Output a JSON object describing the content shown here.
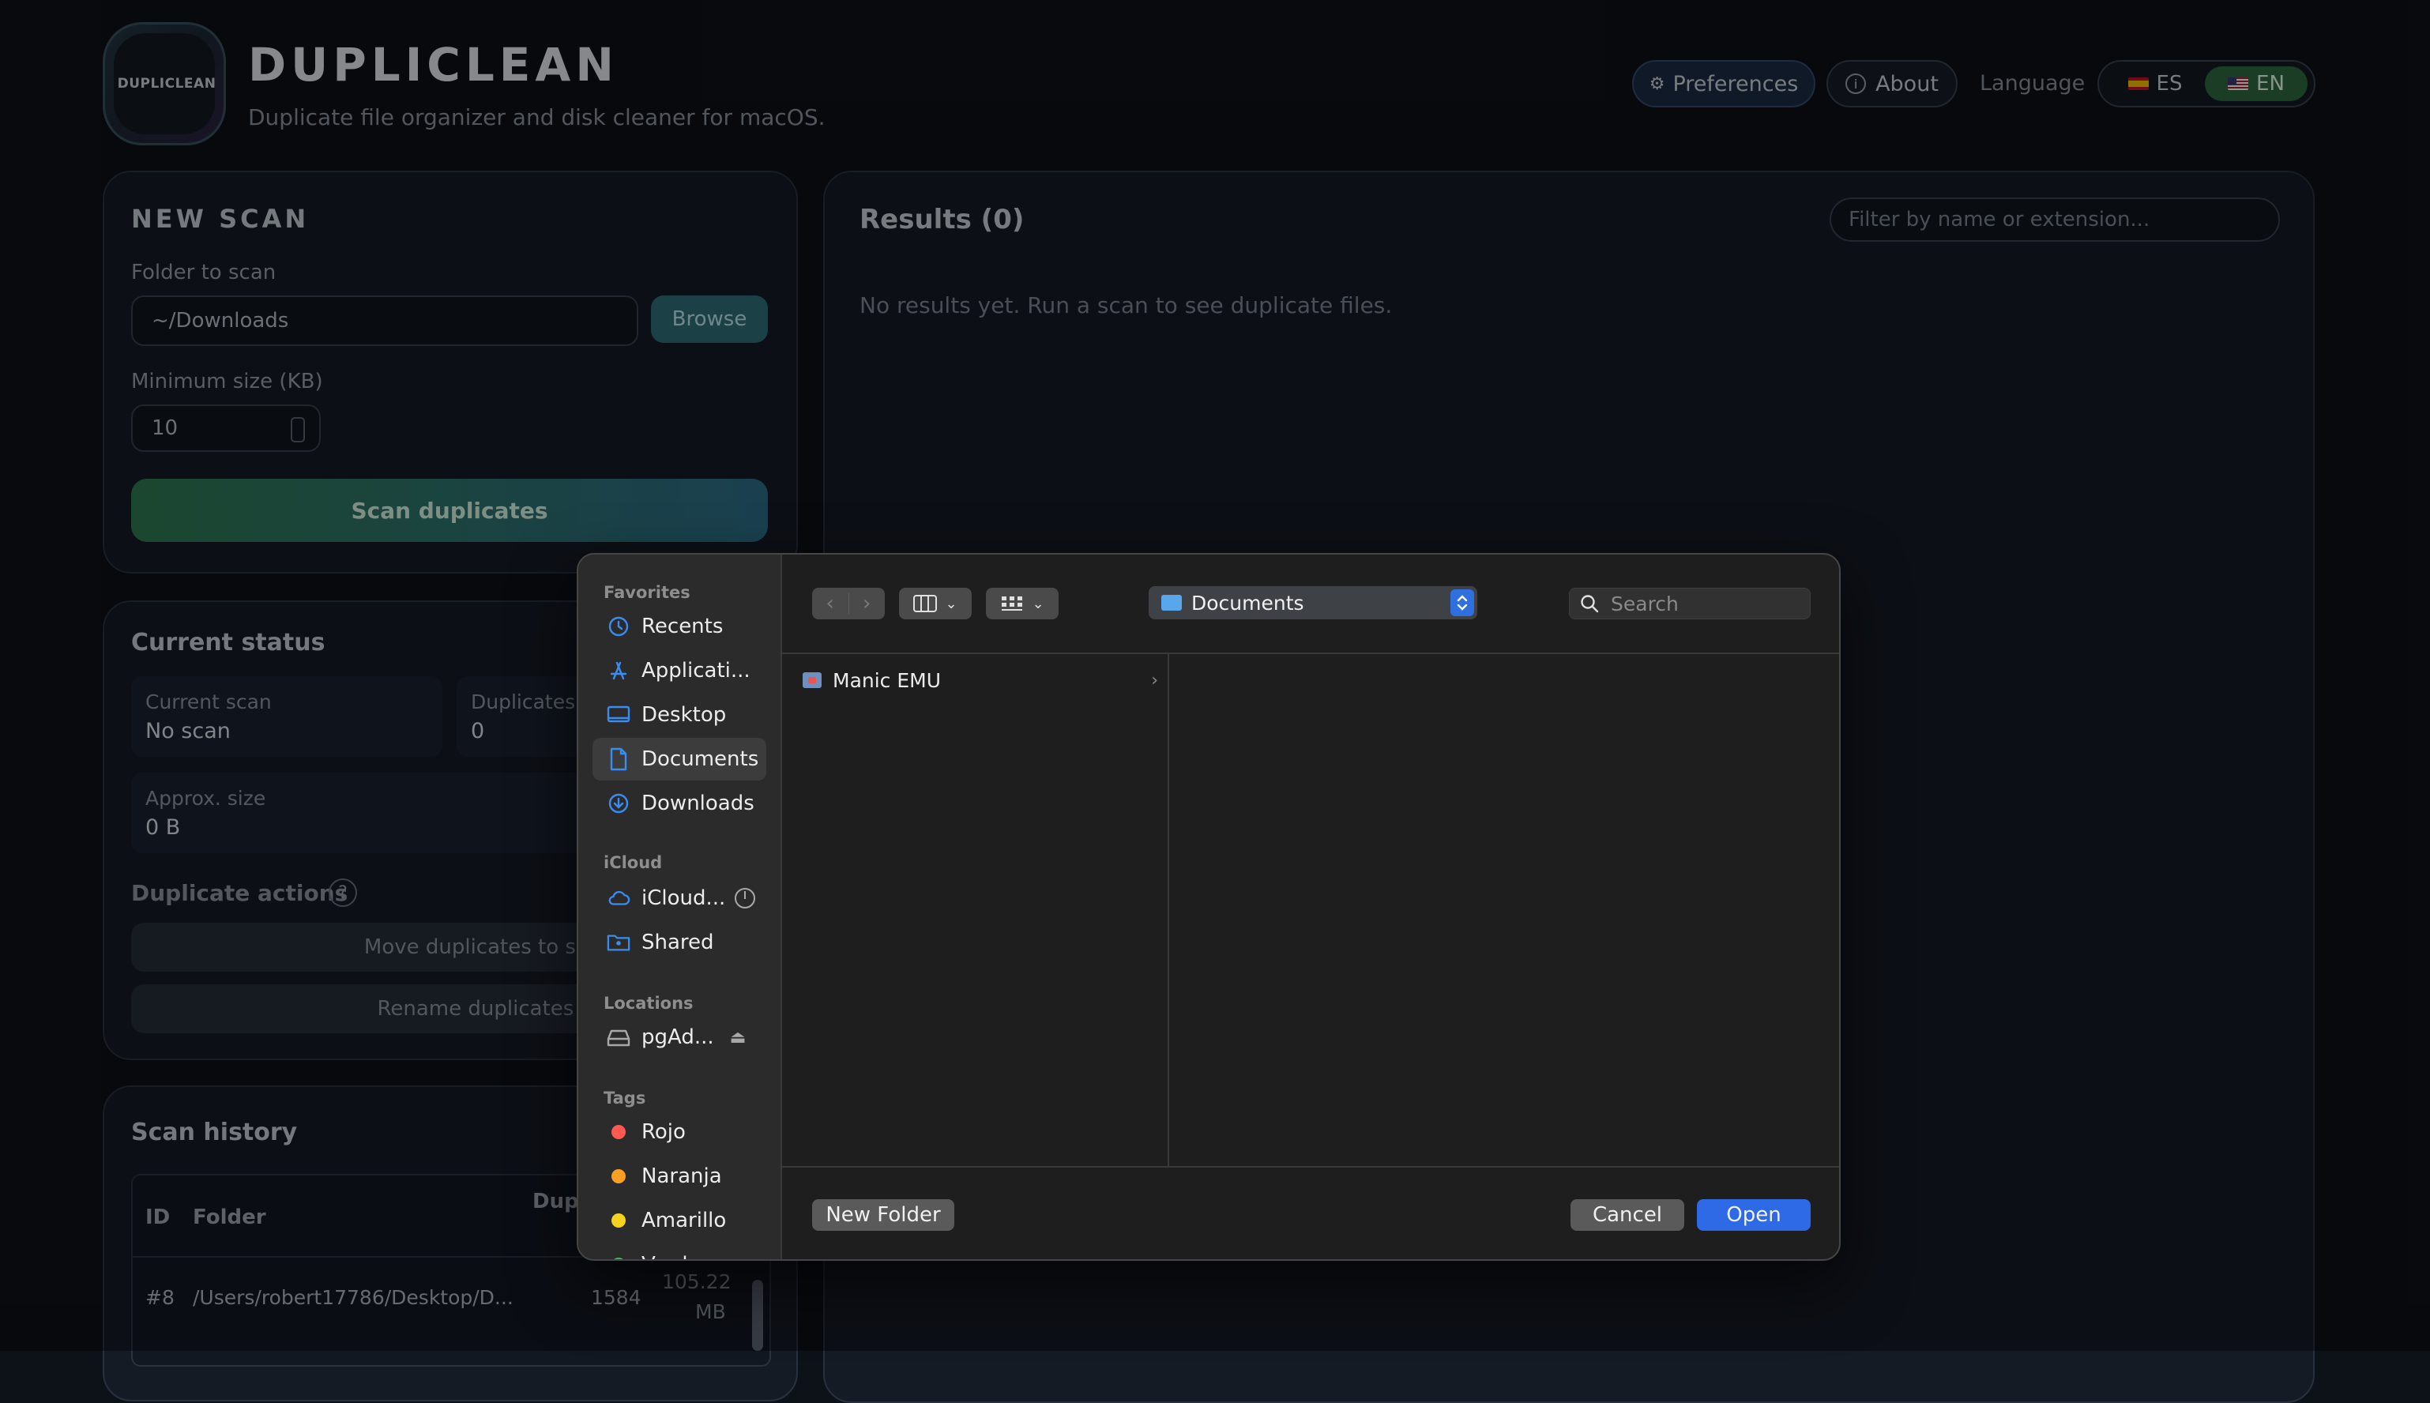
{
  "app": {
    "logo_text": "DUPLICLEAN",
    "title": "DUPLICLEAN",
    "subtitle": "Duplicate file organizer and disk cleaner for macOS."
  },
  "header": {
    "preferences": "Preferences",
    "about": "About",
    "language_label": "Language",
    "lang_es": "ES",
    "lang_en": "EN",
    "active_language": "EN"
  },
  "scan": {
    "title": "NEW SCAN",
    "folder_label": "Folder to scan",
    "folder_value": "~/Downloads",
    "browse": "Browse",
    "min_size_label": "Minimum size (KB)",
    "min_size_value": "10",
    "scan_button": "Scan duplicates"
  },
  "status": {
    "title": "Current status",
    "current_scan_label": "Current scan",
    "current_scan_value": "No scan",
    "duplicates_label": "Duplicates",
    "duplicates_value": "0",
    "approx_size_label": "Approx. size",
    "approx_size_value": "0 B",
    "actions_title": "Duplicate actions",
    "help": "?",
    "move_button": "Move duplicates to safe fold",
    "rename_button": "Rename duplicates in plac"
  },
  "history": {
    "title": "Scan history",
    "columns": [
      "ID",
      "Folder",
      "Dupl"
    ],
    "rows": [
      {
        "id": "#8",
        "folder": "/Users/robert17786/Desktop/D...",
        "dupes": "1584",
        "size_line1": "105.22",
        "size_line2": "MB"
      }
    ]
  },
  "results": {
    "title": "Results (0)",
    "filter_placeholder": "Filter by name or extension...",
    "empty_text": "No results yet. Run a scan to see duplicate files."
  },
  "dialog": {
    "sidebar": {
      "favorites_heading": "Favorites",
      "favorites": [
        {
          "label": "Recents",
          "icon": "clock-icon"
        },
        {
          "label": "Applicati...",
          "icon": "applications-icon"
        },
        {
          "label": "Desktop",
          "icon": "desktop-icon"
        },
        {
          "label": "Documents",
          "icon": "document-icon",
          "selected": true
        },
        {
          "label": "Downloads",
          "icon": "download-icon"
        }
      ],
      "icloud_heading": "iCloud",
      "icloud": [
        {
          "label": "iCloud...",
          "icon": "cloud-icon"
        },
        {
          "label": "Shared",
          "icon": "shared-folder-icon"
        }
      ],
      "locations_heading": "Locations",
      "locations": [
        {
          "label": "pgAd...",
          "icon": "drive-icon"
        }
      ],
      "tags_heading": "Tags",
      "tags": [
        {
          "label": "Rojo",
          "color": "#ff5a52"
        },
        {
          "label": "Naranja",
          "color": "#f9a024"
        },
        {
          "label": "Amarillo",
          "color": "#f5d31e"
        },
        {
          "label": "Verde",
          "color": "#30c35a"
        }
      ]
    },
    "path": "Documents",
    "search_placeholder": "Search",
    "files": [
      {
        "name": "Manic EMU"
      }
    ],
    "new_folder": "New Folder",
    "cancel": "Cancel",
    "open": "Open"
  },
  "colors": {
    "background": "#0d1118",
    "panel": "#151b25",
    "scan_gradient_start": "#2f7a52",
    "scan_gradient_end": "#2e6f8a",
    "dialog_bg": "#1e1e1e",
    "open_button": "#2e6ae6"
  }
}
